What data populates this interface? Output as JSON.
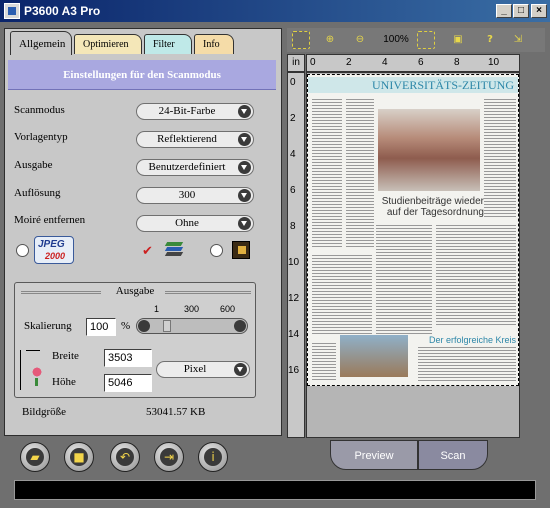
{
  "window": {
    "title": "P3600 A3 Pro"
  },
  "tabs": [
    {
      "label": "Allgemein",
      "active": true
    },
    {
      "label": "Optimieren",
      "active": false
    },
    {
      "label": "Filter",
      "active": false
    },
    {
      "label": "Info",
      "active": false
    }
  ],
  "section_title": "Einstellungen für den Scanmodus",
  "settings": {
    "scanmodus": {
      "label": "Scanmodus",
      "value": "24-Bit-Farbe"
    },
    "vorlagentyp": {
      "label": "Vorlagentyp",
      "value": "Reflektierend"
    },
    "ausgabe": {
      "label": "Ausgabe",
      "value": "Benutzerdefiniert"
    },
    "aufloesung": {
      "label": "Auflösung",
      "value": "300"
    },
    "moire": {
      "label": "Moiré entfernen",
      "value": "Ohne"
    }
  },
  "output_group": {
    "title": "Ausgabe",
    "scale_label": "Skalierung",
    "scale_value": "100",
    "scale_unit": "%",
    "slider_ticks": [
      "1",
      "300",
      "600"
    ],
    "width_label": "Breite",
    "width_value": "3503",
    "height_label": "Höhe",
    "height_value": "5046",
    "unit_value": "Pixel",
    "size_label": "Bildgröße",
    "size_value": "53041.57 KB"
  },
  "toolbar": {
    "zoom_text": "100%"
  },
  "ruler": {
    "corner": "in",
    "top": [
      "0",
      "2",
      "4",
      "6",
      "8",
      "10"
    ],
    "left": [
      "0",
      "2",
      "4",
      "6",
      "8",
      "10",
      "12",
      "14",
      "16"
    ]
  },
  "preview_doc": {
    "masthead": "UNIVERSITÄTS-ZEITUNG",
    "headline_1": "Studienbeiträge wieder",
    "headline_2": "auf der Tagesordnung",
    "side_text": "Der erfolgreiche Kreis"
  },
  "buttons": {
    "preview": "Preview",
    "scan": "Scan"
  }
}
